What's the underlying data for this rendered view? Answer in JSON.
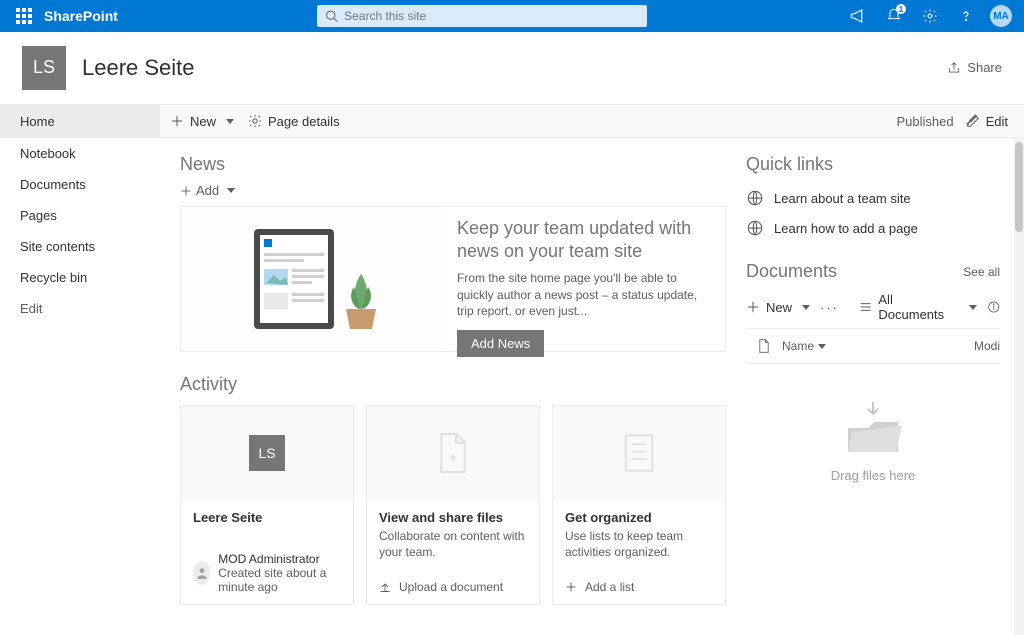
{
  "suite": {
    "brand": "SharePoint",
    "search_placeholder": "Search this site",
    "notification_count": "1",
    "avatar_initials": "MA"
  },
  "site": {
    "logo_initials": "LS",
    "title": "Leere Seite",
    "share_label": "Share"
  },
  "commands": {
    "new_label": "New",
    "page_details_label": "Page details",
    "published_label": "Published",
    "edit_label": "Edit"
  },
  "nav": {
    "items": [
      "Home",
      "Notebook",
      "Documents",
      "Pages",
      "Site contents",
      "Recycle bin"
    ],
    "edit_label": "Edit"
  },
  "news": {
    "section_title": "News",
    "add_label": "Add",
    "headline": "Keep your team updated with news on your team site",
    "body": "From the site home page you'll be able to quickly author a news post – a status update, trip report, or even just...",
    "button_label": "Add News"
  },
  "activity": {
    "section_title": "Activity",
    "cards": [
      {
        "title": "Leere Seite",
        "desc": "",
        "footer_primary": "MOD Administrator",
        "footer_secondary": "Created site about a minute ago"
      },
      {
        "title": "View and share files",
        "desc": "Collaborate on content with your team.",
        "action": "Upload a document"
      },
      {
        "title": "Get organized",
        "desc": "Use lists to keep team activities organized.",
        "action": "Add a list"
      }
    ]
  },
  "quicklinks": {
    "section_title": "Quick links",
    "items": [
      "Learn about a team site",
      "Learn how to add a page"
    ]
  },
  "documents": {
    "section_title": "Documents",
    "see_all": "See all",
    "new_label": "New",
    "view_label": "All Documents",
    "col_name": "Name",
    "col_modified": "Modi",
    "drop_hint": "Drag files here"
  }
}
